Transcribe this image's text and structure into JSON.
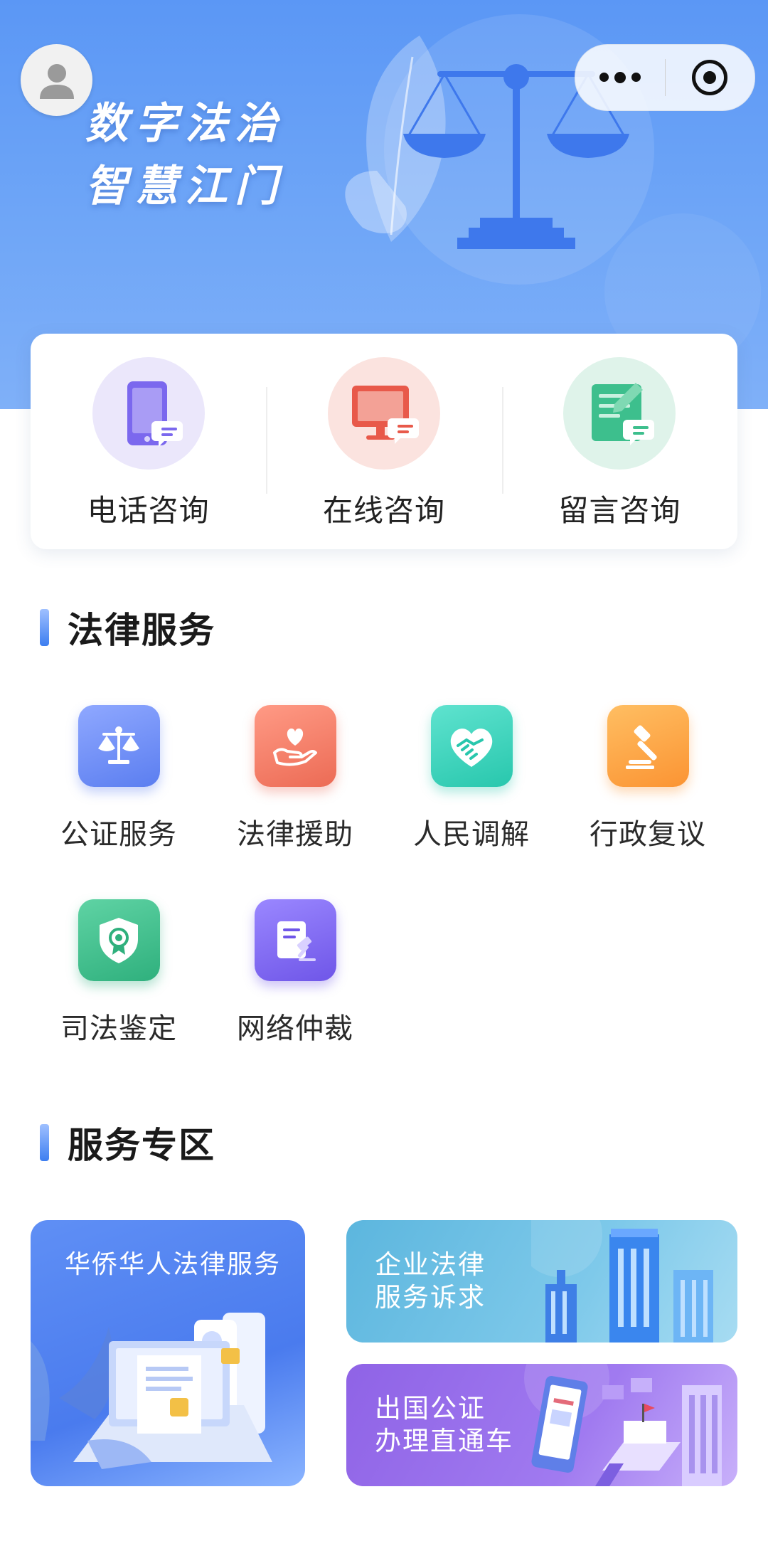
{
  "header": {
    "title_line1": "数字法治",
    "title_line2": "智慧江门"
  },
  "consult": [
    {
      "label": "电话咨询",
      "icon": "tablet-chat-icon",
      "color": "#7b68ee"
    },
    {
      "label": "在线咨询",
      "icon": "monitor-chat-icon",
      "color": "#ef6b57"
    },
    {
      "label": "留言咨询",
      "icon": "notepad-chat-icon",
      "color": "#3dbf8d"
    }
  ],
  "legal_services": {
    "title": "法律服务",
    "items": [
      {
        "label": "公证服务",
        "icon": "scales-icon"
      },
      {
        "label": "法律援助",
        "icon": "heart-hand-icon"
      },
      {
        "label": "人民调解",
        "icon": "handshake-heart-icon"
      },
      {
        "label": "行政复议",
        "icon": "gavel-icon"
      },
      {
        "label": "司法鉴定",
        "icon": "shield-badge-icon"
      },
      {
        "label": "网络仲裁",
        "icon": "document-gavel-icon"
      }
    ]
  },
  "zone": {
    "title": "服务专区",
    "overseas": {
      "label": "华侨华人法律服务"
    },
    "enterprise": {
      "line1": "企业法律",
      "line2": "服务诉求"
    },
    "abroad": {
      "line1": "出国公证",
      "line2": "办理直通车"
    }
  }
}
